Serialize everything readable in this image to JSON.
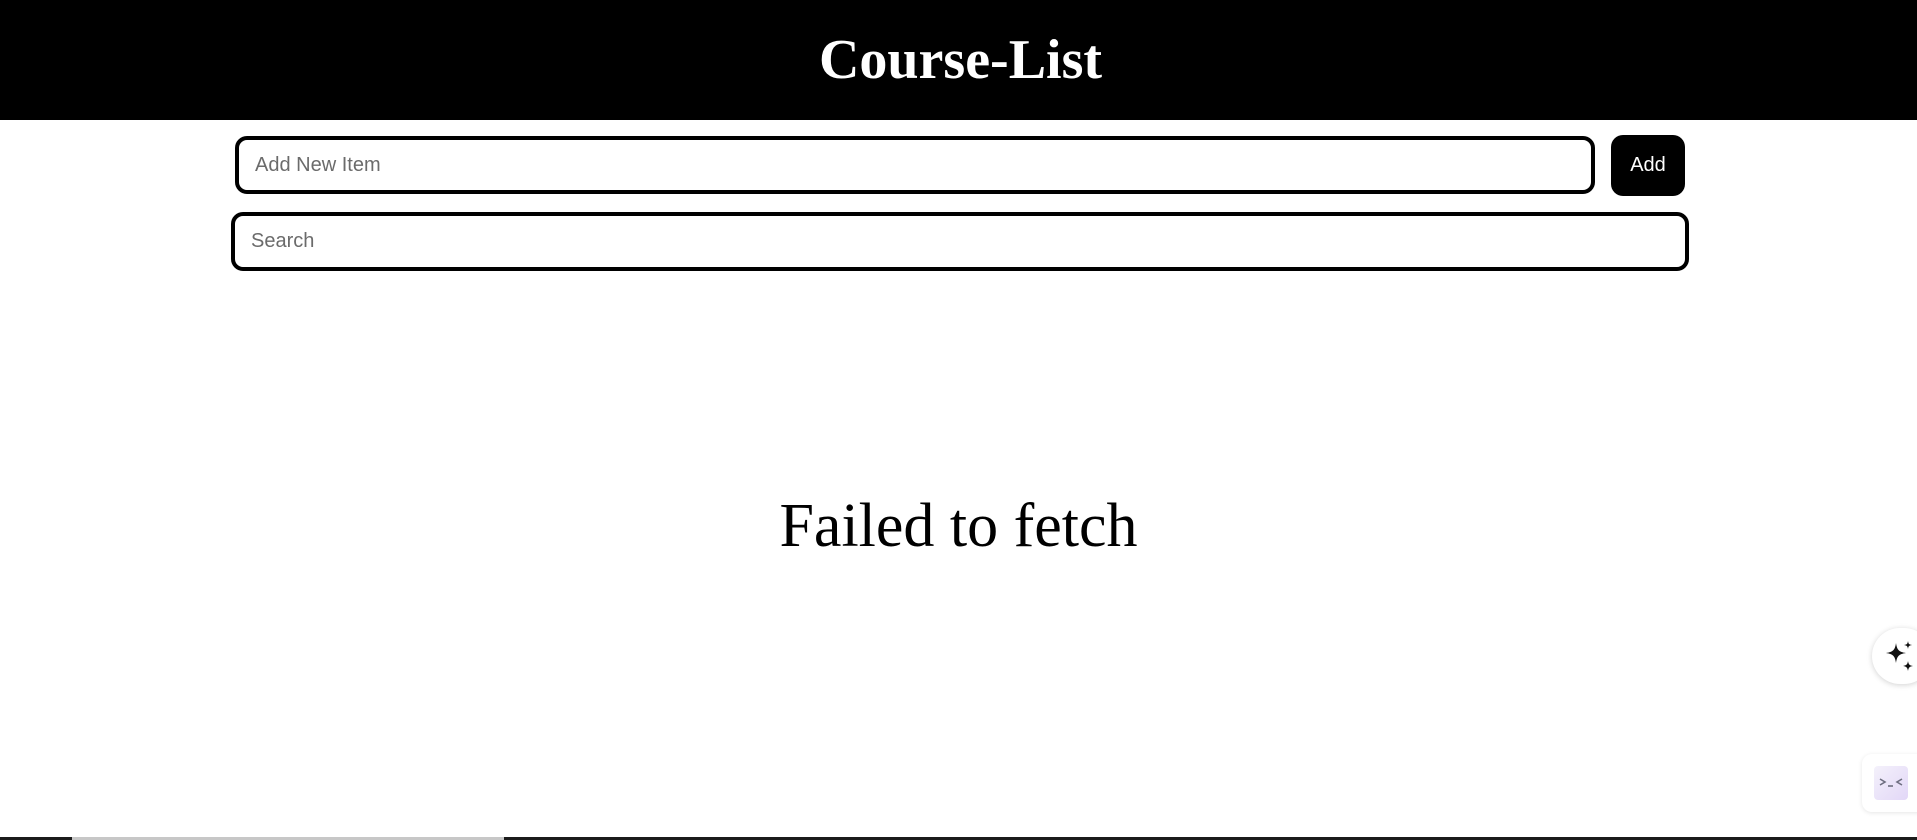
{
  "header": {
    "title": "Course-List"
  },
  "add_item": {
    "placeholder": "Add New Item",
    "value": "",
    "button_label": "Add"
  },
  "search": {
    "placeholder": "Search",
    "value": ""
  },
  "status": {
    "error_message": "Failed to fetch"
  },
  "floating": {
    "assistant_icon": "sparkle-icon",
    "widget_icon": "face-widget-icon"
  },
  "colors": {
    "header_bg": "#000000",
    "header_text": "#ffffff",
    "button_bg": "#000000",
    "button_text": "#ffffff",
    "input_border": "#000000",
    "page_bg": "#ffffff"
  }
}
